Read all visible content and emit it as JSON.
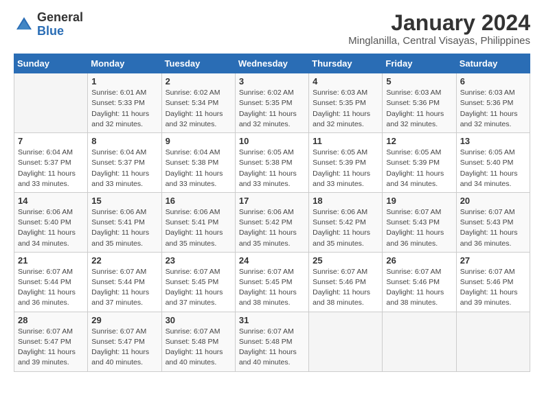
{
  "logo": {
    "general": "General",
    "blue": "Blue"
  },
  "title": "January 2024",
  "subtitle": "Minglanilla, Central Visayas, Philippines",
  "days_header": [
    "Sunday",
    "Monday",
    "Tuesday",
    "Wednesday",
    "Thursday",
    "Friday",
    "Saturday"
  ],
  "weeks": [
    [
      {
        "num": "",
        "info": ""
      },
      {
        "num": "1",
        "info": "Sunrise: 6:01 AM\nSunset: 5:33 PM\nDaylight: 11 hours\nand 32 minutes."
      },
      {
        "num": "2",
        "info": "Sunrise: 6:02 AM\nSunset: 5:34 PM\nDaylight: 11 hours\nand 32 minutes."
      },
      {
        "num": "3",
        "info": "Sunrise: 6:02 AM\nSunset: 5:35 PM\nDaylight: 11 hours\nand 32 minutes."
      },
      {
        "num": "4",
        "info": "Sunrise: 6:03 AM\nSunset: 5:35 PM\nDaylight: 11 hours\nand 32 minutes."
      },
      {
        "num": "5",
        "info": "Sunrise: 6:03 AM\nSunset: 5:36 PM\nDaylight: 11 hours\nand 32 minutes."
      },
      {
        "num": "6",
        "info": "Sunrise: 6:03 AM\nSunset: 5:36 PM\nDaylight: 11 hours\nand 32 minutes."
      }
    ],
    [
      {
        "num": "7",
        "info": "Sunrise: 6:04 AM\nSunset: 5:37 PM\nDaylight: 11 hours\nand 33 minutes."
      },
      {
        "num": "8",
        "info": "Sunrise: 6:04 AM\nSunset: 5:37 PM\nDaylight: 11 hours\nand 33 minutes."
      },
      {
        "num": "9",
        "info": "Sunrise: 6:04 AM\nSunset: 5:38 PM\nDaylight: 11 hours\nand 33 minutes."
      },
      {
        "num": "10",
        "info": "Sunrise: 6:05 AM\nSunset: 5:38 PM\nDaylight: 11 hours\nand 33 minutes."
      },
      {
        "num": "11",
        "info": "Sunrise: 6:05 AM\nSunset: 5:39 PM\nDaylight: 11 hours\nand 33 minutes."
      },
      {
        "num": "12",
        "info": "Sunrise: 6:05 AM\nSunset: 5:39 PM\nDaylight: 11 hours\nand 34 minutes."
      },
      {
        "num": "13",
        "info": "Sunrise: 6:05 AM\nSunset: 5:40 PM\nDaylight: 11 hours\nand 34 minutes."
      }
    ],
    [
      {
        "num": "14",
        "info": "Sunrise: 6:06 AM\nSunset: 5:40 PM\nDaylight: 11 hours\nand 34 minutes."
      },
      {
        "num": "15",
        "info": "Sunrise: 6:06 AM\nSunset: 5:41 PM\nDaylight: 11 hours\nand 35 minutes."
      },
      {
        "num": "16",
        "info": "Sunrise: 6:06 AM\nSunset: 5:41 PM\nDaylight: 11 hours\nand 35 minutes."
      },
      {
        "num": "17",
        "info": "Sunrise: 6:06 AM\nSunset: 5:42 PM\nDaylight: 11 hours\nand 35 minutes."
      },
      {
        "num": "18",
        "info": "Sunrise: 6:06 AM\nSunset: 5:42 PM\nDaylight: 11 hours\nand 35 minutes."
      },
      {
        "num": "19",
        "info": "Sunrise: 6:07 AM\nSunset: 5:43 PM\nDaylight: 11 hours\nand 36 minutes."
      },
      {
        "num": "20",
        "info": "Sunrise: 6:07 AM\nSunset: 5:43 PM\nDaylight: 11 hours\nand 36 minutes."
      }
    ],
    [
      {
        "num": "21",
        "info": "Sunrise: 6:07 AM\nSunset: 5:44 PM\nDaylight: 11 hours\nand 36 minutes."
      },
      {
        "num": "22",
        "info": "Sunrise: 6:07 AM\nSunset: 5:44 PM\nDaylight: 11 hours\nand 37 minutes."
      },
      {
        "num": "23",
        "info": "Sunrise: 6:07 AM\nSunset: 5:45 PM\nDaylight: 11 hours\nand 37 minutes."
      },
      {
        "num": "24",
        "info": "Sunrise: 6:07 AM\nSunset: 5:45 PM\nDaylight: 11 hours\nand 38 minutes."
      },
      {
        "num": "25",
        "info": "Sunrise: 6:07 AM\nSunset: 5:46 PM\nDaylight: 11 hours\nand 38 minutes."
      },
      {
        "num": "26",
        "info": "Sunrise: 6:07 AM\nSunset: 5:46 PM\nDaylight: 11 hours\nand 38 minutes."
      },
      {
        "num": "27",
        "info": "Sunrise: 6:07 AM\nSunset: 5:46 PM\nDaylight: 11 hours\nand 39 minutes."
      }
    ],
    [
      {
        "num": "28",
        "info": "Sunrise: 6:07 AM\nSunset: 5:47 PM\nDaylight: 11 hours\nand 39 minutes."
      },
      {
        "num": "29",
        "info": "Sunrise: 6:07 AM\nSunset: 5:47 PM\nDaylight: 11 hours\nand 40 minutes."
      },
      {
        "num": "30",
        "info": "Sunrise: 6:07 AM\nSunset: 5:48 PM\nDaylight: 11 hours\nand 40 minutes."
      },
      {
        "num": "31",
        "info": "Sunrise: 6:07 AM\nSunset: 5:48 PM\nDaylight: 11 hours\nand 40 minutes."
      },
      {
        "num": "",
        "info": ""
      },
      {
        "num": "",
        "info": ""
      },
      {
        "num": "",
        "info": ""
      }
    ]
  ]
}
